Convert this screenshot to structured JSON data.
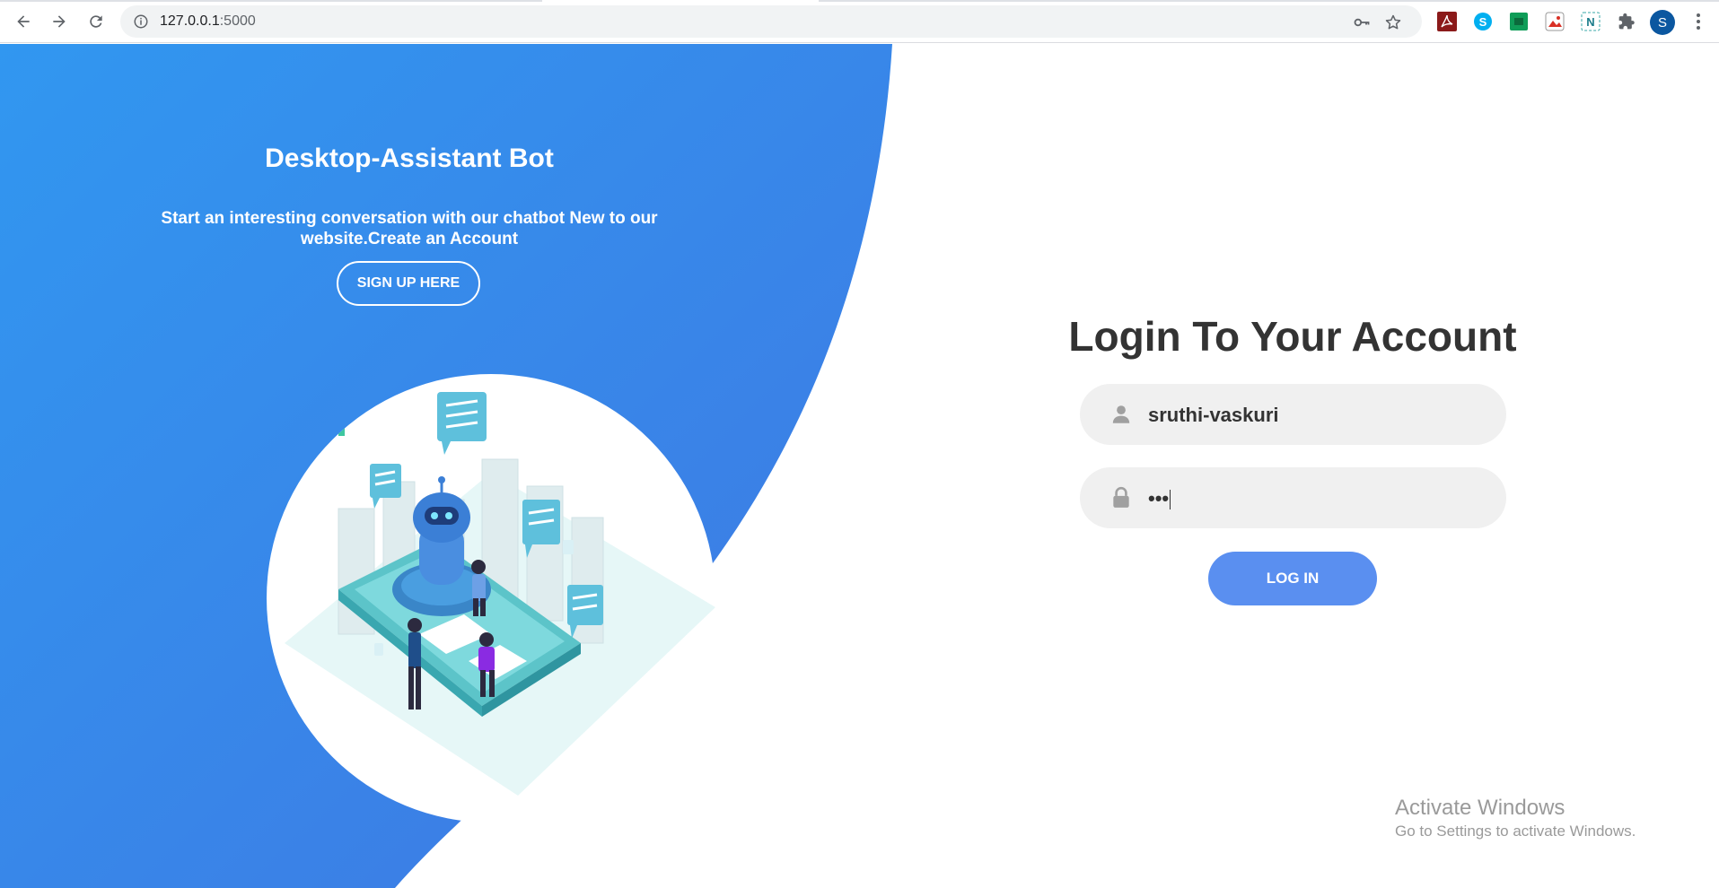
{
  "browser": {
    "url_host": "127.0.0.1",
    "url_port": ":5000",
    "profile_initial": "S",
    "icons": [
      "back-icon",
      "forward-icon",
      "reload-icon",
      "site-info-icon",
      "key-icon",
      "star-icon",
      "adobe-pdf-extension-icon",
      "skype-extension-icon",
      "sheets-extension-icon",
      "image-extension-icon",
      "notion-extension-icon",
      "extensions-puzzle-icon",
      "menu-dots-icon"
    ]
  },
  "left": {
    "title": "Desktop-Assistant Bot",
    "subtitle": "Start an interesting conversation with our chatbot New to our website.Create an Account",
    "signup_label": "SIGN UP HERE",
    "colors": {
      "gradient_start": "#3197f0",
      "gradient_end": "#3f79e4"
    }
  },
  "login": {
    "title": "Login To Your Account",
    "username_value": "sruthi-vaskuri",
    "password_value": "•••",
    "login_label": "LOG IN",
    "button_color": "#5a8ff0",
    "field_icons": [
      "user-icon",
      "lock-icon"
    ]
  },
  "watermark": {
    "title": "Activate Windows",
    "subtitle": "Go to Settings to activate Windows."
  }
}
